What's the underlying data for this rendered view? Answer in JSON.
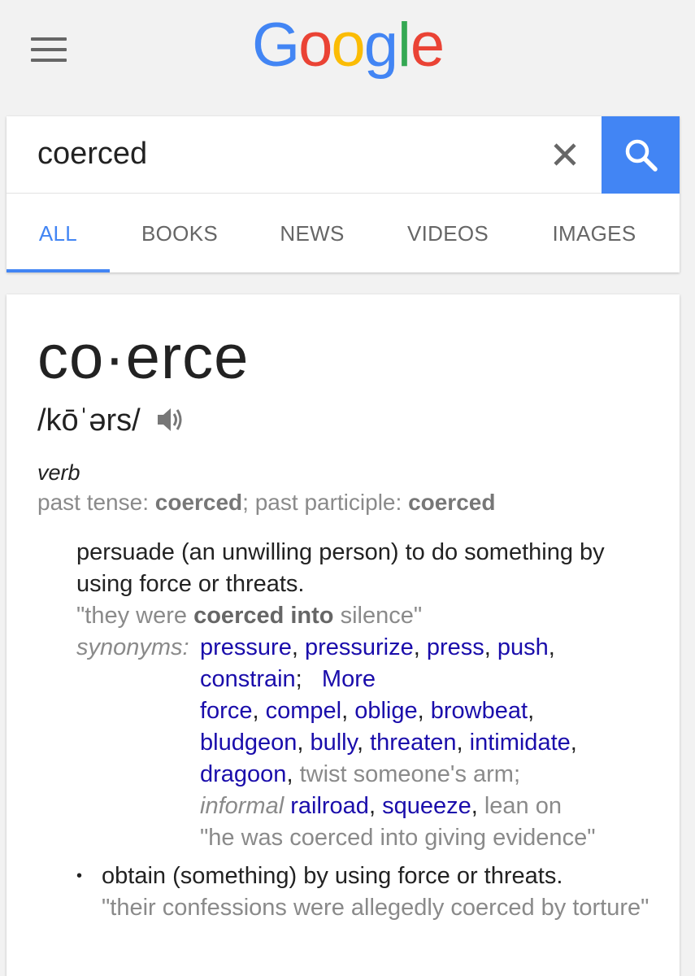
{
  "header": {
    "logo_letters": [
      {
        "ch": "G",
        "color": "#4285f4"
      },
      {
        "ch": "o",
        "color": "#ea4335"
      },
      {
        "ch": "o",
        "color": "#fbbc05"
      },
      {
        "ch": "g",
        "color": "#4285f4"
      },
      {
        "ch": "l",
        "color": "#34a853"
      },
      {
        "ch": "e",
        "color": "#ea4335"
      }
    ],
    "menu_icon": "hamburger-menu-icon"
  },
  "search": {
    "query": "coerced",
    "clear_icon": "close-icon",
    "search_icon": "search-icon",
    "accent": "#4285f4"
  },
  "tabs": [
    {
      "label": "ALL",
      "active": true
    },
    {
      "label": "BOOKS",
      "active": false
    },
    {
      "label": "NEWS",
      "active": false
    },
    {
      "label": "VIDEOS",
      "active": false
    },
    {
      "label": "IMAGES",
      "active": false
    }
  ],
  "definition": {
    "headword": "co·erce",
    "phonetic": "/kōˈərs/",
    "audio_icon": "speaker-icon",
    "part_of_speech": "verb",
    "forms": {
      "past_tense_label": "past tense:",
      "past_tense": "coerced",
      "sep": ";",
      "past_participle_label": "past participle:",
      "past_participle": "coerced"
    },
    "sense1": {
      "text": "persuade (an unwilling person) to do something by using force or threats.",
      "example_pre": "\"they were ",
      "example_bold": "coerced into",
      "example_post": " silence\"",
      "synonyms_label": "synonyms:",
      "syn_line1": [
        "pressure",
        "pressurize",
        "press",
        "push"
      ],
      "syn_line2_word": "constrain",
      "more_label": "More",
      "syn_line3": [
        "force",
        "compel",
        "oblige",
        "browbeat"
      ],
      "syn_line4": [
        "bludgeon",
        "bully",
        "threaten",
        "intimidate"
      ],
      "syn_line5_link": "dragoon",
      "syn_line5_plain": "twist someone's arm;",
      "informal_label": "informal",
      "syn_line6_links": [
        "railroad",
        "squeeze"
      ],
      "syn_line6_plain": "lean on",
      "example2": "\"he was coerced into giving evidence\""
    },
    "sense2": {
      "bullet": "•",
      "text": "obtain (something) by using force or threats.",
      "example": "\"their confessions were allegedly coerced by torture\""
    }
  }
}
